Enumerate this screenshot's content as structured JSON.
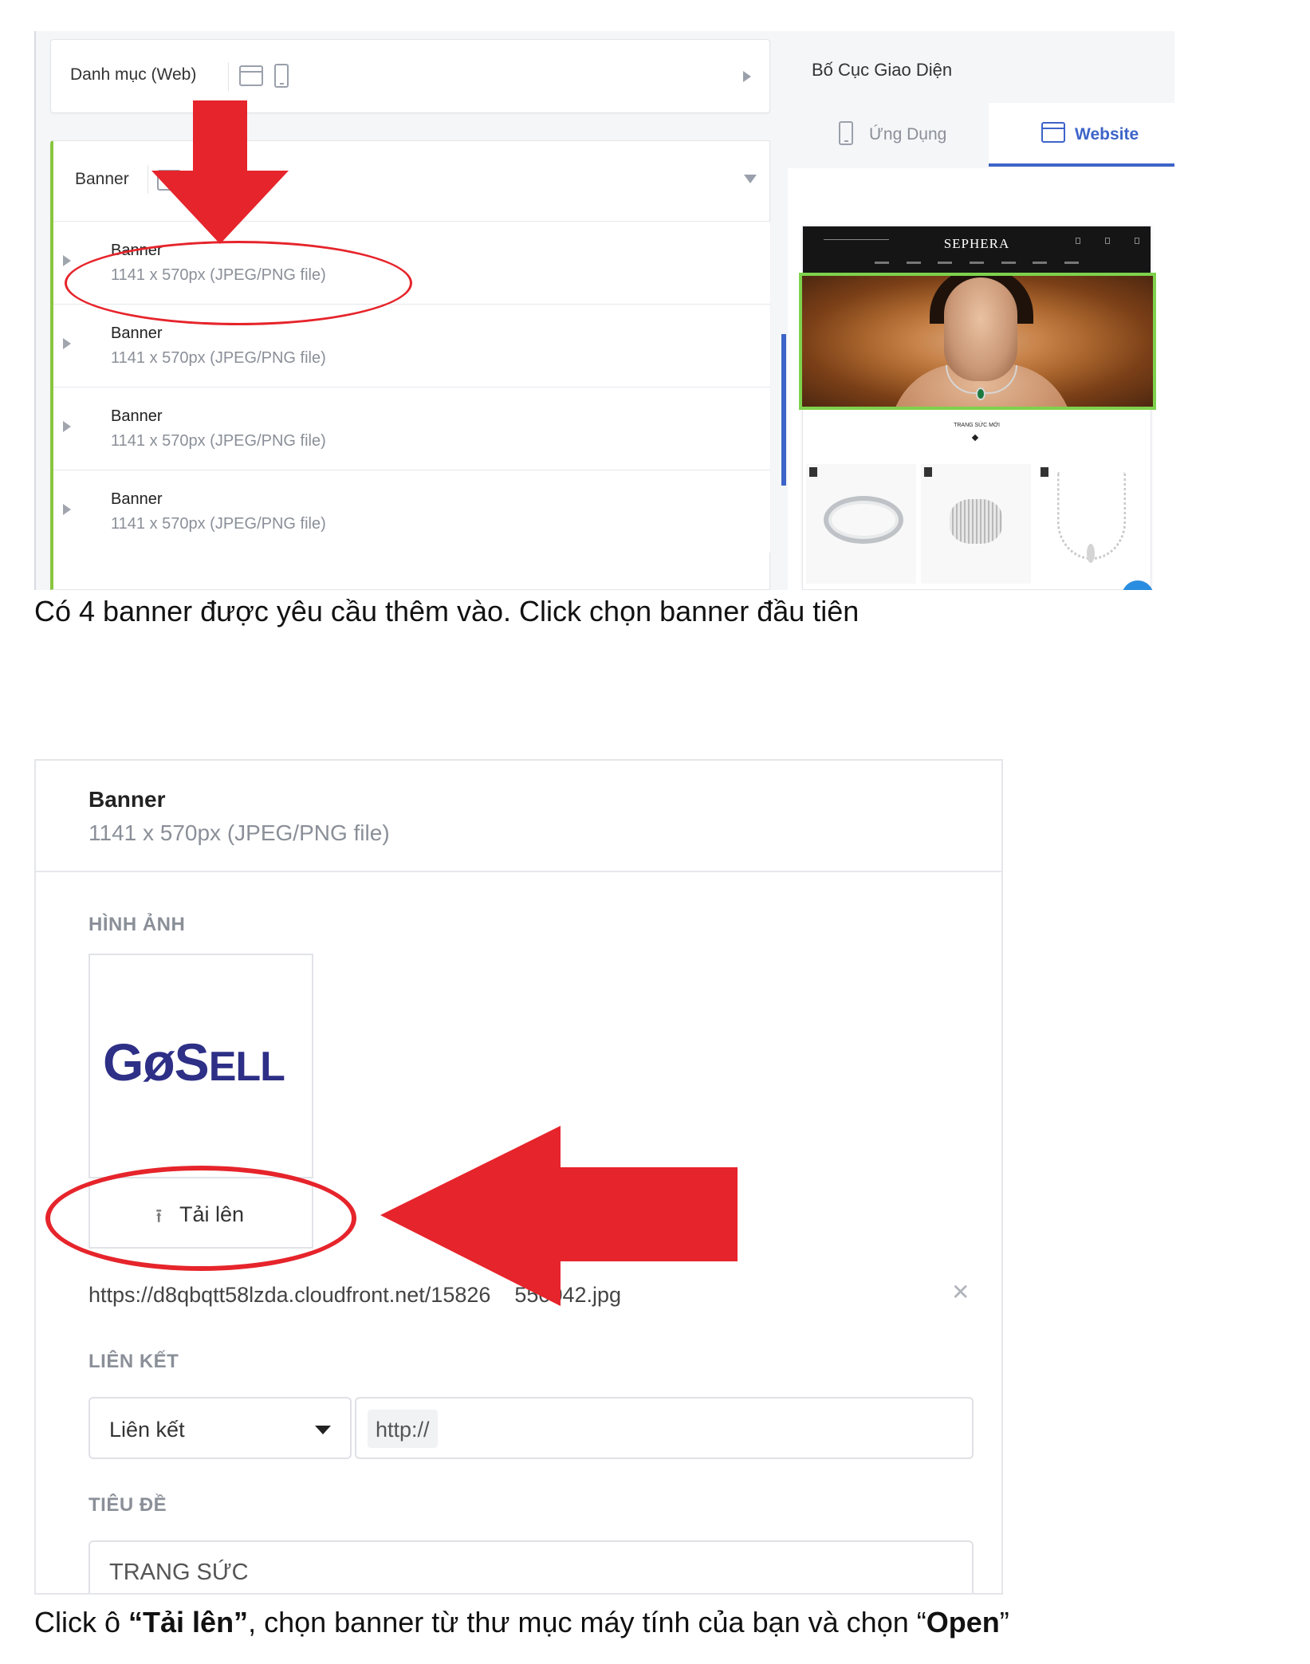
{
  "shot1": {
    "category_card": {
      "title": "Danh mục (Web)"
    },
    "banner_section": {
      "title": "Banner",
      "items": [
        {
          "title": "Banner",
          "subtitle": "1141 x 570px (JPEG/PNG file)"
        },
        {
          "title": "Banner",
          "subtitle": "1141 x 570px (JPEG/PNG file)"
        },
        {
          "title": "Banner",
          "subtitle": "1141 x 570px (JPEG/PNG file)"
        },
        {
          "title": "Banner",
          "subtitle": "1141 x 570px (JPEG/PNG file)"
        }
      ]
    },
    "layout_panel": {
      "title": "Bố Cục Giao Diện",
      "tabs": [
        {
          "label": "Ứng Dụng",
          "active": false
        },
        {
          "label": "Website",
          "active": true
        }
      ],
      "preview": {
        "brand": "SEPHERA",
        "section_title": "TRANG SỨC MỚI"
      }
    },
    "highlight_color": "#e6242b",
    "accent_color": "#3d64c8",
    "active_section_color": "#8ac540"
  },
  "caption1": "Có 4 banner được yêu cầu thêm vào. Click chọn banner đầu tiên",
  "shot2": {
    "header": {
      "title": "Banner",
      "subtitle": "1141 x 570px (JPEG/PNG file)"
    },
    "image_label": "HÌNH ẢNH",
    "logo_text": {
      "g": "G",
      "o": "ø",
      "rest_big": "S",
      "rest_small": "ELL"
    },
    "upload_button": "Tải lên",
    "upload_icon": "upload-arrow-icon",
    "image_url": "https://d8qbqtt58lzda.cloudfront.net/15826",
    "image_url_tail": "550042.jpg",
    "link_label": "LIÊN KẾT",
    "link_type": "Liên kết",
    "link_prefix": "http://",
    "title_label": "TIÊU ĐỀ",
    "title_value": "TRANG SỨC"
  },
  "caption2": {
    "part1": "Click ô ",
    "bold1": "“Tải lên”",
    "part2": ", chọn banner từ thư mục máy tính của bạn và chọn “",
    "bold2": "Open",
    "part3": "”"
  }
}
